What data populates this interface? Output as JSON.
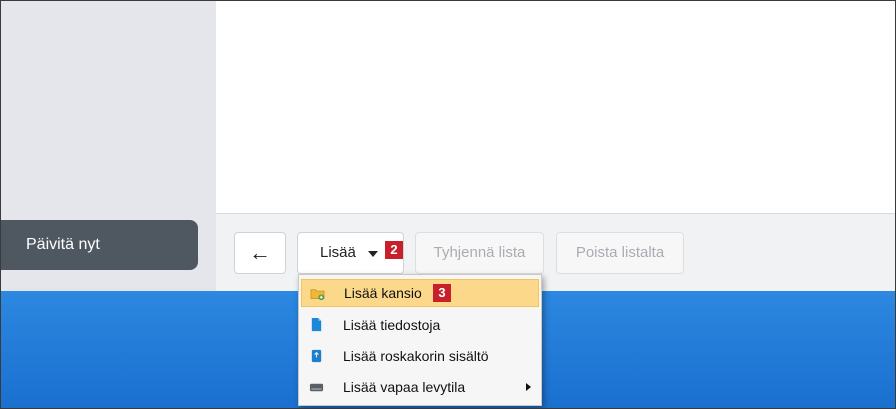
{
  "sidebar": {
    "update_label": "Päivitä nyt"
  },
  "toolbar": {
    "back_label": "←",
    "add_label": "Lisää",
    "clear_label": "Tyhjennä lista",
    "remove_label": "Poista listalta"
  },
  "annotations": {
    "step_add": "2",
    "step_folder": "3"
  },
  "menu": {
    "items": [
      {
        "label": "Lisää kansio",
        "icon": "folder-add-icon"
      },
      {
        "label": "Lisää tiedostoja",
        "icon": "file-icon"
      },
      {
        "label": "Lisää roskakorin sisältö",
        "icon": "recycle-bin-icon"
      },
      {
        "label": "Lisää vapaa levytila",
        "icon": "drive-icon"
      }
    ]
  },
  "colors": {
    "sidebar_bg": "#e4e6eb",
    "update_button_bg": "#4f5761",
    "menu_highlight": "#fcd98a",
    "badge": "#c8202a",
    "desktop_blue": "#2c88e0"
  }
}
